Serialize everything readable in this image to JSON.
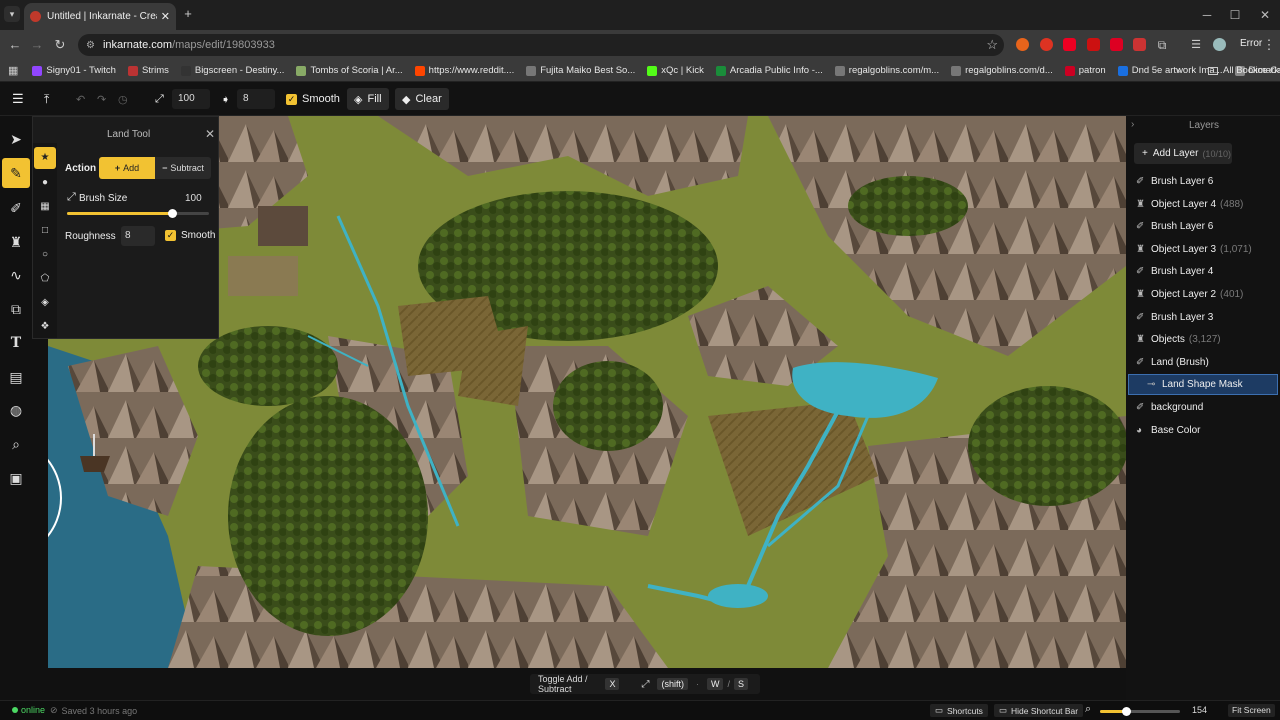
{
  "browser": {
    "tab_title": "Untitled | Inkarnate - Create Fa",
    "url_host": "inkarnate.com",
    "url_path": "/maps/edit/19803933",
    "profile_label": "Error",
    "bookmarks": [
      {
        "label": "Signy01 - Twitch",
        "color": "#9146ff"
      },
      {
        "label": "Strims",
        "color": "#b33"
      },
      {
        "label": "Bigscreen - Destiny...",
        "color": "#333"
      },
      {
        "label": "Tombs of Scoria | Ar...",
        "color": "#8a6"
      },
      {
        "label": "https://www.reddit....",
        "color": "#ff4500"
      },
      {
        "label": "Fujita Maiko Best So...",
        "color": "#777"
      },
      {
        "label": "xQc | Kick",
        "color": "#53fc18"
      },
      {
        "label": "Arcadia Public Info -...",
        "color": "#1a8d3a"
      },
      {
        "label": "regalgoblins.com/m...",
        "color": "#777"
      },
      {
        "label": "regalgoblins.com/d...",
        "color": "#777"
      },
      {
        "label": "patron",
        "color": "#c02"
      },
      {
        "label": "Dnd 5e artwork Ima...",
        "color": "#1a6fe0"
      },
      {
        "label": "Dice Calculator",
        "color": "#888"
      }
    ],
    "all_bookmarks": "All Bookmarks"
  },
  "toolbar": {
    "size_value": "100",
    "roughness_value": "8",
    "smooth_label": "Smooth",
    "fill_label": "Fill",
    "clear_label": "Clear"
  },
  "land_tool": {
    "title": "Land Tool",
    "action_label": "Action",
    "add_label": "Add",
    "subtract_label": "Subtract",
    "brush_size_label": "Brush Size",
    "brush_size_value": "100",
    "brush_size_fraction": 0.74,
    "roughness_label": "Roughness",
    "roughness_value": "8",
    "smooth_label": "Smooth"
  },
  "layers": {
    "title": "Layers",
    "add_layer_label": "Add Layer",
    "add_layer_count": "(10/10)",
    "items": [
      {
        "label": "Brush Layer 6",
        "count": "",
        "icon": "brush-icon"
      },
      {
        "label": "Object Layer 4",
        "count": "(488)",
        "icon": "tower-icon"
      },
      {
        "label": "Brush Layer 6",
        "count": "",
        "icon": "brush-icon"
      },
      {
        "label": "Object Layer 3",
        "count": "(1,071)",
        "icon": "tower-icon"
      },
      {
        "label": "Brush Layer 4",
        "count": "",
        "icon": "brush-icon"
      },
      {
        "label": "Object Layer 2",
        "count": "(401)",
        "icon": "tower-icon"
      },
      {
        "label": "Brush Layer 3",
        "count": "",
        "icon": "brush-icon"
      },
      {
        "label": "Objects",
        "count": "(3,127)",
        "icon": "tower-icon"
      },
      {
        "label": "Land (Brush)",
        "count": "",
        "icon": "brush-icon"
      },
      {
        "label": "Land Shape Mask",
        "count": "",
        "icon": "mask-icon"
      },
      {
        "label": "background",
        "count": "",
        "icon": "brush-icon"
      },
      {
        "label": "Base Color",
        "count": "",
        "icon": "palette-icon"
      }
    ]
  },
  "shortcut_bar": {
    "label": "Toggle Add / Subtract",
    "key_x": "X",
    "key_shift": "(shift)",
    "key_w": "W",
    "key_s": "S",
    "sep": "/"
  },
  "status": {
    "online": "online",
    "saved": "Saved 3 hours ago",
    "shortcuts": "Shortcuts",
    "hide_shortcut_bar": "Hide Shortcut Bar",
    "zoom_value": "154",
    "fit_screen": "Fit Screen",
    "zoom_fraction": 0.33
  },
  "colors": {
    "accent": "#f2c232",
    "selected_layer": "#1d3b63",
    "water": "#3fb2c4",
    "grass": "#7f8a35"
  }
}
